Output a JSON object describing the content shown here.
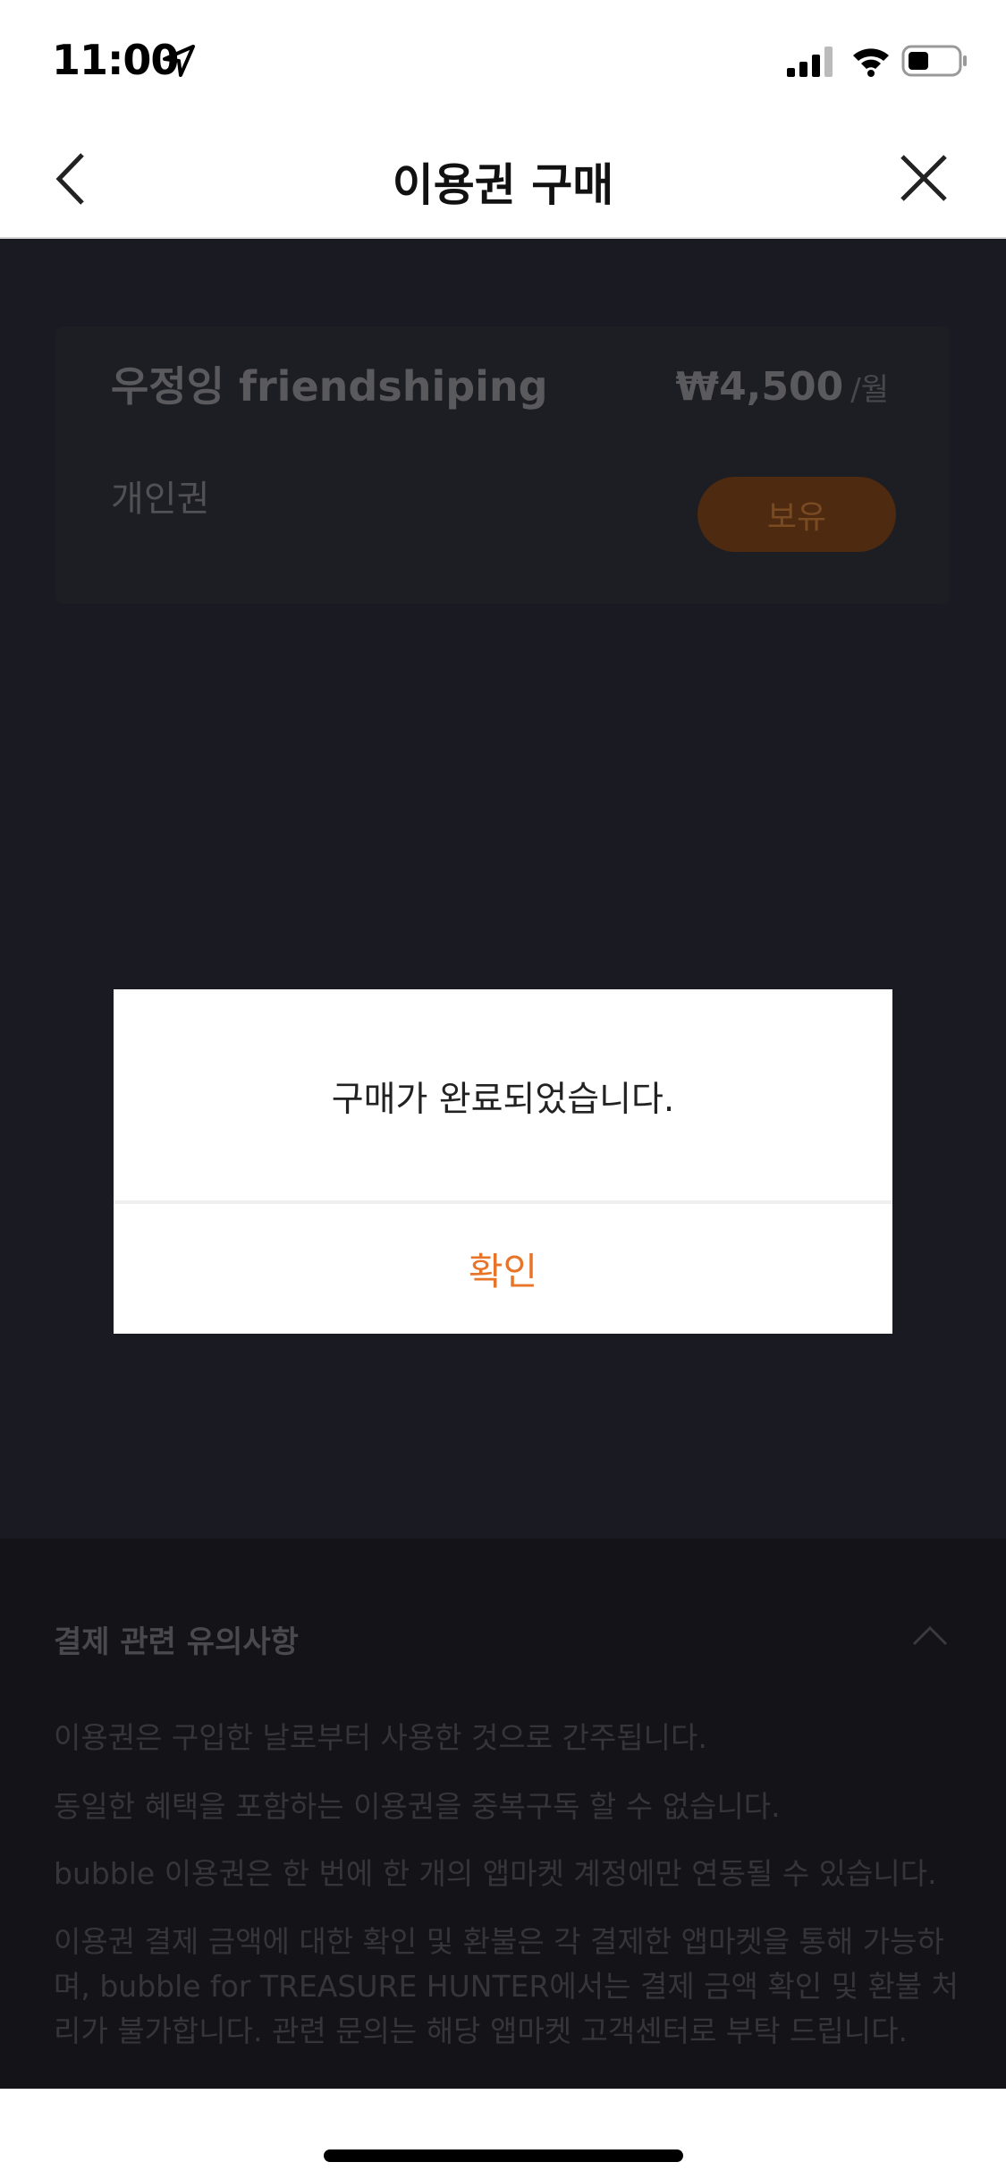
{
  "status_bar": {
    "time": "11:00"
  },
  "nav": {
    "title": "이용권 구매"
  },
  "plan": {
    "name": "우정잉 friendshiping",
    "type": "개인권",
    "price": "₩4,500",
    "period": "/월",
    "owned_label": "보유"
  },
  "notice": {
    "title": "결제 관련 유의사항",
    "lines": [
      "이용권은 구입한 날로부터 사용한 것으로 간주됩니다.",
      "동일한 혜택을 포함하는 이용권을 중복구독 할 수 없습니다.",
      "bubble 이용권은 한 번에 한 개의 앱마켓 계정에만 연동될 수 있습니다.",
      "이용권 결제 금액에 대한 확인 및 환불은 각 결제한 앱마켓을 통해 가능하며, bubble for TREASURE HUNTER에서는 결제 금액 확인 및 환불 처리가 불가합니다. 관련 문의는 해당 앱마켓 고객센터로 부탁 드립니다."
    ]
  },
  "dialog": {
    "message": "구매가 완료되었습니다.",
    "confirm_label": "확인"
  },
  "colors": {
    "accent": "#e8742a",
    "background_dark": "#1a1a22"
  }
}
